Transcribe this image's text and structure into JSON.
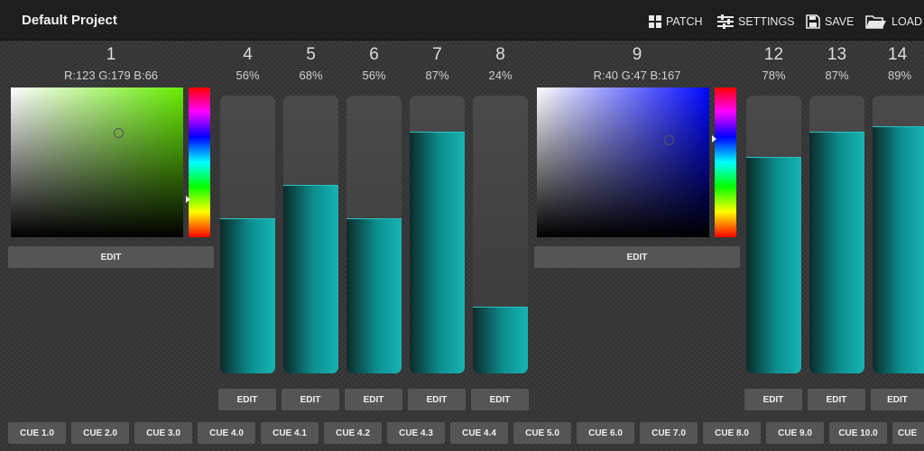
{
  "header": {
    "title": "Default Project",
    "patch_label": "PATCH",
    "settings_label": "SETTINGS",
    "save_label": "SAVE",
    "load_label": "LOAD"
  },
  "color_channels": [
    {
      "number": "1",
      "value": "R:123 G:179 B:66",
      "edit_label": "EDIT",
      "color": "#7bb342"
    },
    {
      "number": "9",
      "value": "R:40 G:47 B:167",
      "edit_label": "EDIT",
      "color": "#282fa7"
    }
  ],
  "faders": [
    {
      "number": "4",
      "value": "56%",
      "level": 56,
      "edit_label": "EDIT"
    },
    {
      "number": "5",
      "value": "68%",
      "level": 68,
      "edit_label": "EDIT"
    },
    {
      "number": "6",
      "value": "56%",
      "level": 56,
      "edit_label": "EDIT"
    },
    {
      "number": "7",
      "value": "87%",
      "level": 87,
      "edit_label": "EDIT"
    },
    {
      "number": "8",
      "value": "24%",
      "level": 24,
      "edit_label": "EDIT"
    },
    {
      "number": "12",
      "value": "78%",
      "level": 78,
      "edit_label": "EDIT"
    },
    {
      "number": "13",
      "value": "87%",
      "level": 87,
      "edit_label": "EDIT"
    },
    {
      "number": "14",
      "value": "89%",
      "level": 89,
      "edit_label": "EDIT"
    }
  ],
  "cues": [
    "CUE 1.0",
    "CUE 2.0",
    "CUE 3.0",
    "CUE 4.0",
    "CUE 4.1",
    "CUE 4.2",
    "CUE 4.3",
    "CUE 4.4",
    "CUE 5.0",
    "CUE 6.0",
    "CUE 7.0",
    "CUE 8.0",
    "CUE 9.0",
    "CUE 10.0",
    "CUE"
  ],
  "colors": {
    "accent": "#14a9a9",
    "topbar": "#1e1e1e",
    "button": "#555555"
  }
}
